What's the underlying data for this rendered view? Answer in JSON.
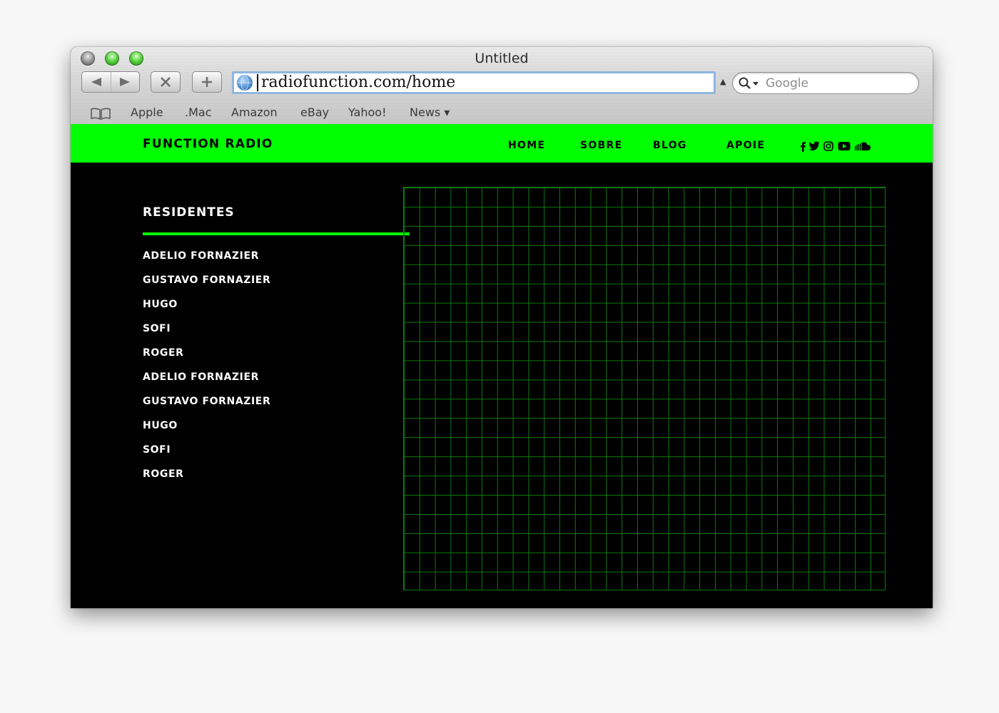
{
  "browser": {
    "window_title": "Untitled",
    "url": "radiofunction.com/home",
    "search_placeholder": "Google",
    "bookmarks": [
      "Apple",
      ".Mac",
      "Amazon",
      "eBay",
      "Yahoo!",
      "News ▾"
    ]
  },
  "site": {
    "brand": "FUNCTION RADIO",
    "nav": [
      "HOME",
      "SOBRE",
      "BLOG",
      "APOIE"
    ],
    "social_icons": [
      "facebook-icon",
      "twitter-icon",
      "instagram-icon",
      "youtube-icon",
      "soundcloud-icon"
    ],
    "accent_color": "#00ff00",
    "residents": {
      "heading": "RESIDENTES",
      "items": [
        "ADELIO FORNAZIER",
        "GUSTAVO FORNAZIER",
        "HUGO",
        "SOFI",
        "ROGER",
        "ADELIO FORNAZIER",
        "GUSTAVO FORNAZIER",
        "HUGO",
        "SOFI",
        "ROGER"
      ]
    }
  }
}
